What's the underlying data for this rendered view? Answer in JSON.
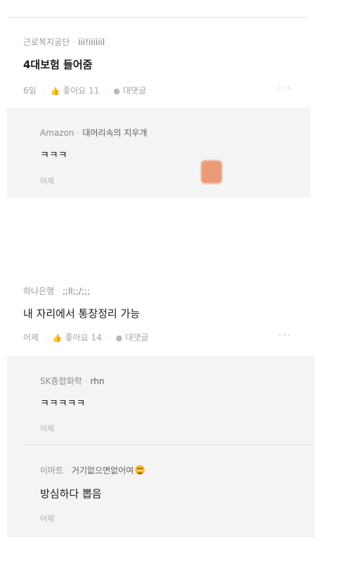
{
  "posts": [
    {
      "company": "근로복지공단",
      "nickname": "iii!iiiiiil",
      "title": "4대보험 들어줌",
      "time": "6일",
      "likes": "좋아요 11",
      "reply_label": "대댓글",
      "more": "···",
      "replies": [
        {
          "company": "Amazon",
          "nickname": "대머리속의 지우개",
          "text": "ㅋㅋㅋ",
          "time": "어제"
        }
      ]
    },
    {
      "company": "하나은행",
      "nickname": ";;ll;;/;;;",
      "title": "내 자리에서 통장정리 가능",
      "time": "어제",
      "likes": "좋아요 14",
      "reply_label": "대댓글",
      "more": "···",
      "replies": [
        {
          "company": "SK종합화학",
          "nickname": "rhn",
          "text": "ㅋㅋㅋㅋㅋ",
          "time": "어제"
        },
        {
          "company": "이마트",
          "nickname": "거기없으면없어여",
          "text": "방심하다 뽑음",
          "time": "어제"
        }
      ]
    }
  ],
  "icons": {
    "like": "thumbs-up-icon",
    "comment": "comment-bubble-icon",
    "emoji": "smiley-emoji-icon"
  },
  "colors": {
    "reply_bg": "#f4f4f4",
    "emoji": "#f7c33a"
  }
}
